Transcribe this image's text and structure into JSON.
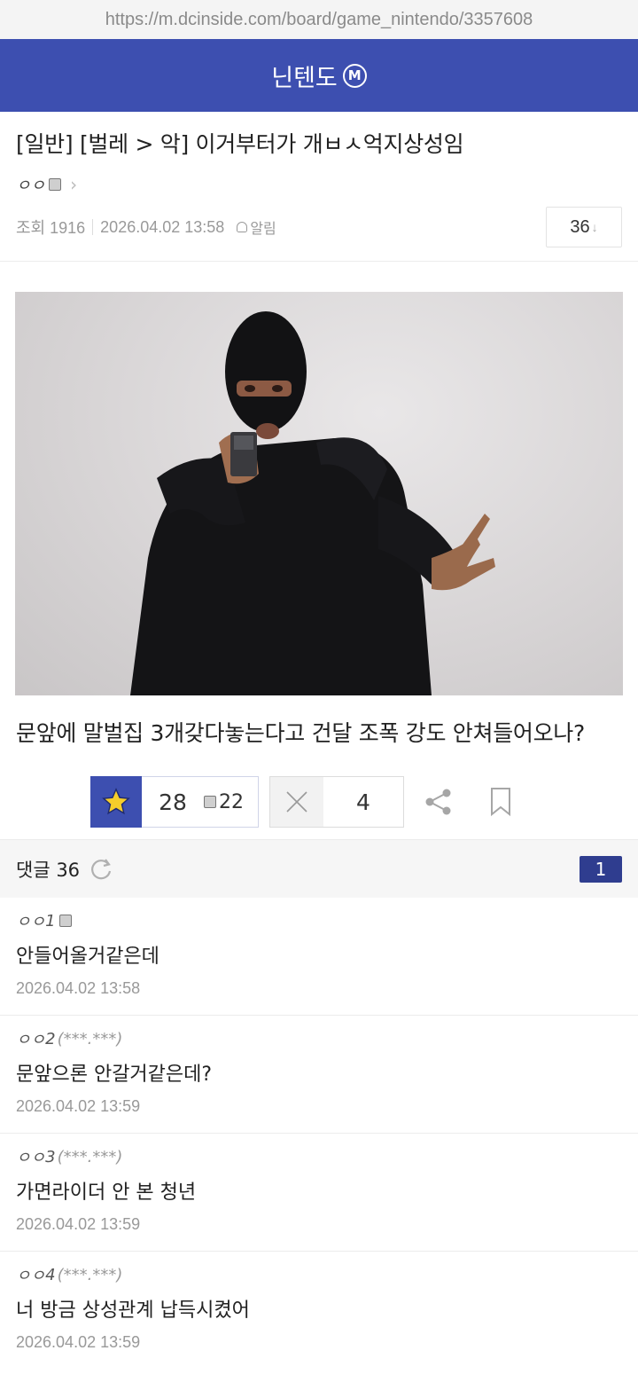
{
  "browser": {
    "url": "https://m.dcinside.com/board/game_nintendo/3357608"
  },
  "header": {
    "gallery_name": "닌텐도",
    "badge": "M"
  },
  "post": {
    "title": "[일반] [벌레 > 악] 이거부터가 개ㅂㅅ억지상성임",
    "author": "ㅇㅇ",
    "meta": {
      "views": "조회 1916",
      "datetime": "2026.04.02 13:58",
      "alarm": "알림"
    },
    "reply_count": "36",
    "body": "문앞에 말벌집 3개갖다놓는다고 건달 조폭 강도 안쳐들어오나?"
  },
  "actions": {
    "recommend": "28",
    "fixed_recommend": "22",
    "non_recommend": "4"
  },
  "comments_bar": {
    "label": "댓글 36",
    "page": "1"
  },
  "comments": [
    {
      "author": "ㅇㅇ",
      "suffix": "1",
      "ip": "",
      "text": "안들어올거같은데",
      "date": "2026.04.02 13:58"
    },
    {
      "author": "ㅇㅇ",
      "suffix": "2",
      "ip": "(***.***)",
      "text": "문앞으론 안갈거같은데?",
      "date": "2026.04.02 13:59"
    },
    {
      "author": "ㅇㅇ",
      "suffix": "3",
      "ip": "(***.***)",
      "text": "가면라이더 안 본 청년",
      "date": "2026.04.02 13:59"
    },
    {
      "author": "ㅇㅇ",
      "suffix": "4",
      "ip": "(***.***)",
      "text": "너 방금 상성관계 납득시켰어",
      "date": "2026.04.02 13:59"
    }
  ],
  "colors": {
    "brand": "#3d4fb0",
    "star": "#f5cd2b"
  }
}
